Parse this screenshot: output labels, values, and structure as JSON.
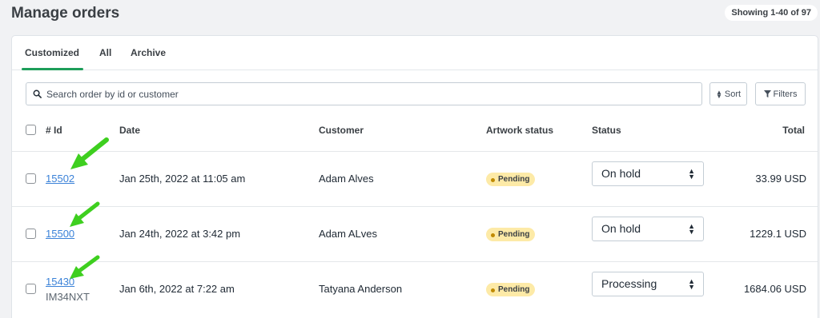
{
  "header": {
    "title": "Manage orders",
    "showing": "Showing 1-40 of 97"
  },
  "tabs": [
    {
      "label": "Customized",
      "active": true
    },
    {
      "label": "All"
    },
    {
      "label": "Archive"
    }
  ],
  "search": {
    "placeholder": "Search order by id or customer"
  },
  "toolbar": {
    "sort_label": "Sort",
    "filters_label": "Filters"
  },
  "table": {
    "columns": [
      "# Id",
      "Date",
      "Customer",
      "Artwork status",
      "Status",
      "Total"
    ],
    "rows": [
      {
        "id": "15502",
        "sub": "",
        "date": "Jan 25th, 2022 at 11:05 am",
        "customer": "Adam Alves",
        "artwork": "Pending",
        "status": "On hold",
        "total": "33.99 USD"
      },
      {
        "id": "15500",
        "sub": "",
        "date": "Jan 24th, 2022 at 3:42 pm",
        "customer": "Adam ALves",
        "artwork": "Pending",
        "status": "On hold",
        "total": "1229.1 USD"
      },
      {
        "id": "15430",
        "sub": "IM34NXT",
        "date": "Jan 6th, 2022 at 7:22 am",
        "customer": "Tatyana Anderson",
        "artwork": "Pending",
        "status": "Processing",
        "total": "1684.06 USD"
      }
    ]
  },
  "colors": {
    "accent": "#1e9e5a",
    "link": "#3b82d8",
    "pending_bg": "#fdeaa7",
    "annotation_arrow": "#3ecf1f"
  }
}
